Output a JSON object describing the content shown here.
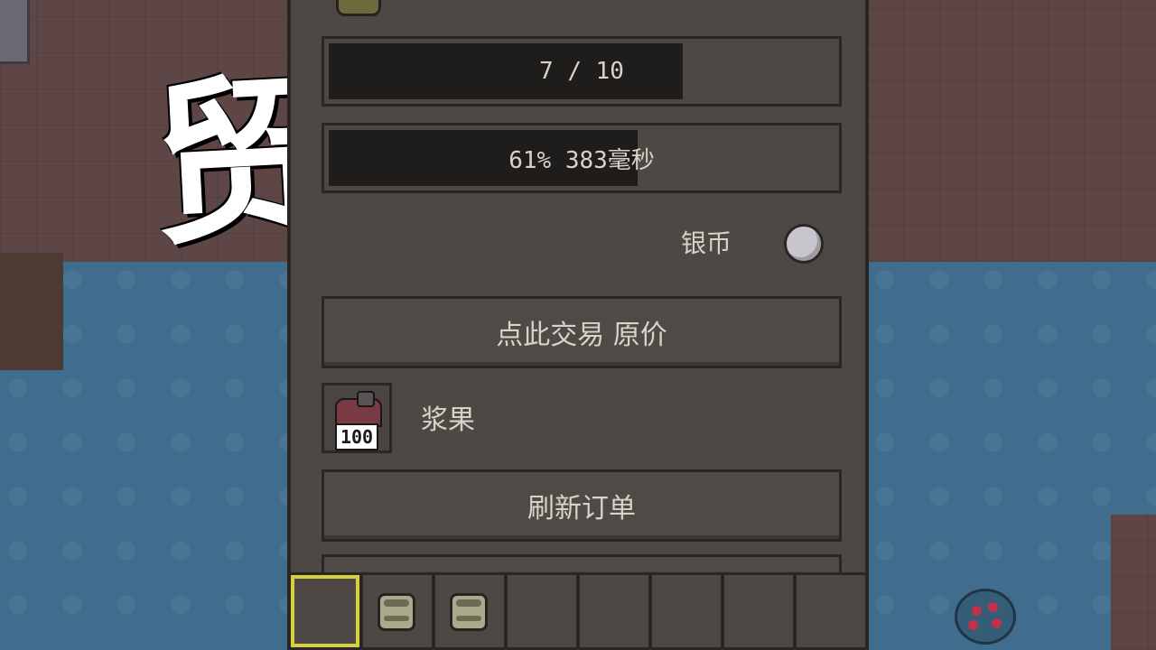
{
  "trade_title": "贸易",
  "orders": {
    "count_text": "7 / 10",
    "count_value": 7,
    "count_max": 10,
    "timer_text": "61%  383毫秒",
    "timer_fraction": 0.61
  },
  "currency": {
    "label": "银币",
    "icon": "silver-coin-icon",
    "color": "#c8c6cc"
  },
  "trade_button_label": "点此交易 原价",
  "trade_item": {
    "icon": "berry-basket-icon",
    "count": "100",
    "name": "浆果"
  },
  "refresh_button_label": "刷新订单",
  "hotbar": {
    "slots": [
      {
        "item": null,
        "selected": true
      },
      {
        "item": "roll-icon",
        "selected": false
      },
      {
        "item": "roll-icon",
        "selected": false
      },
      {
        "item": null,
        "selected": false
      },
      {
        "item": null,
        "selected": false
      },
      {
        "item": null,
        "selected": false
      },
      {
        "item": null,
        "selected": false
      },
      {
        "item": null,
        "selected": false
      }
    ],
    "selected_color": "#d8cf3c"
  },
  "colors": {
    "panel": "#4d4844",
    "border": "#2a2623",
    "text": "#d8d2c8",
    "water": "#406d8d",
    "ground": "#5e4646"
  }
}
